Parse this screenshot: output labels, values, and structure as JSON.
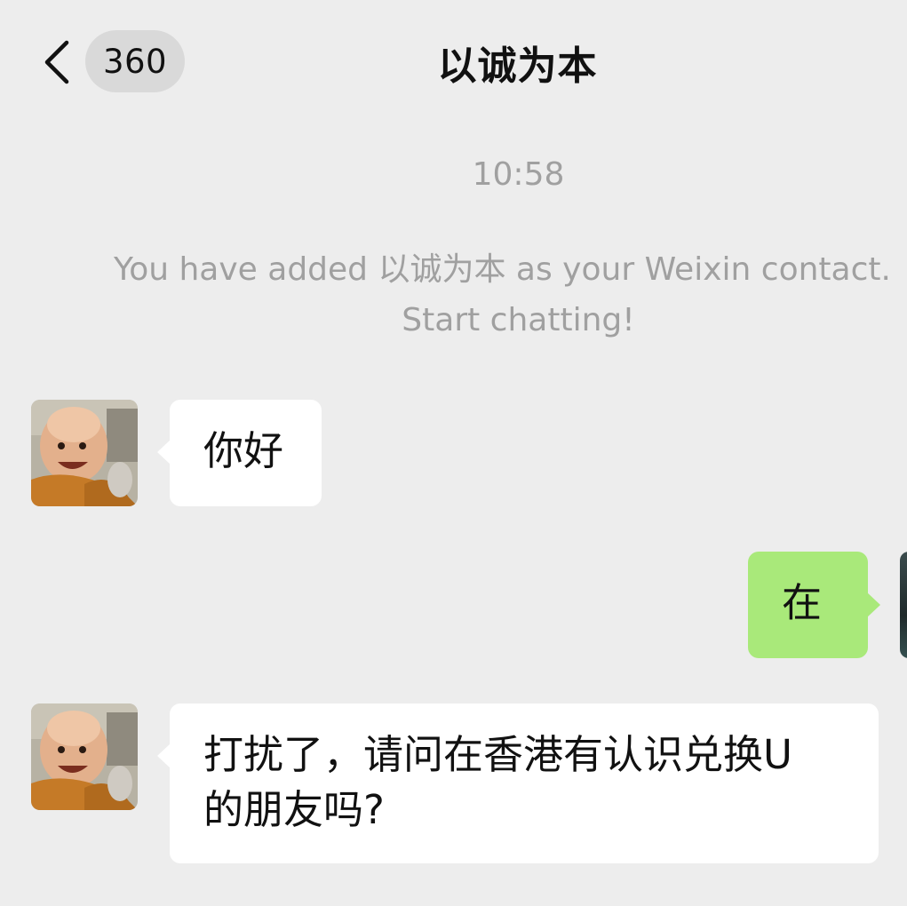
{
  "header": {
    "back_icon": "chevron-left-icon",
    "unread_count": "360",
    "title": "以诚为本"
  },
  "system": {
    "time": "10:58",
    "added_line1": "You have added 以诚为本 as your Weixin contact.",
    "added_line2": "Start chatting!"
  },
  "messages": [
    {
      "side": "left",
      "text": "你好"
    },
    {
      "side": "right",
      "text": "在"
    },
    {
      "side": "left",
      "text": "打扰了，请问在香港有认识兑换U\n的朋友吗?"
    }
  ],
  "colors": {
    "background": "#ededed",
    "bubble_self": "#a9e97a",
    "bubble_other": "#ffffff",
    "system_text": "#a0a0a0",
    "pill": "#d9d9d9"
  }
}
